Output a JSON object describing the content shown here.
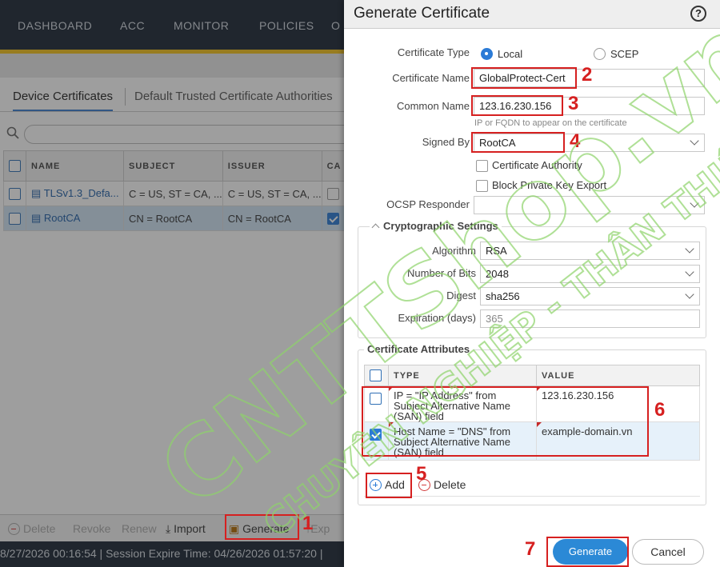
{
  "nav": [
    "DASHBOARD",
    "ACC",
    "MONITOR",
    "POLICIES",
    "O"
  ],
  "tabs": [
    "Device Certificates",
    "Default Trusted Certificate Authorities"
  ],
  "table": {
    "headers": [
      "NAME",
      "SUBJECT",
      "ISSUER",
      "CA"
    ],
    "rows": [
      {
        "name": "TLSv1.3_Defa...",
        "subject": "C = US, ST = CA, ...",
        "issuer": "C = US, ST = CA, ..."
      },
      {
        "name": "RootCA",
        "subject": "CN = RootCA",
        "issuer": "CN = RootCA"
      }
    ]
  },
  "bottombar": {
    "delete": "Delete",
    "revoke": "Revoke",
    "renew": "Renew",
    "import": "Import",
    "generate": "Generate",
    "export": "Exp"
  },
  "status": "8/27/2026 00:16:54 | Session Expire Time: 04/26/2026 01:57:20 |",
  "dialog": {
    "title": "Generate Certificate",
    "help": "?",
    "cert_type_label": "Certificate Type",
    "local": "Local",
    "scep": "SCEP",
    "cert_name_label": "Certificate Name",
    "cert_name": "GlobalProtect-Cert",
    "common_name_label": "Common Name",
    "common_name": "123.16.230.156",
    "common_name_hint": "IP or FQDN to appear on the certificate",
    "signed_by_label": "Signed By",
    "signed_by": "RootCA",
    "cert_authority": "Certificate Authority",
    "block_export": "Block Private Key Export",
    "ocsp_label": "OCSP Responder",
    "crypto_title": "Cryptographic Settings",
    "algorithm_label": "Algorithm",
    "algorithm": "RSA",
    "bits_label": "Number of Bits",
    "bits": "2048",
    "digest_label": "Digest",
    "digest": "sha256",
    "expiration_label": "Expiration (days)",
    "expiration": "365",
    "attrs_title": "Certificate Attributes",
    "attr_headers": [
      "TYPE",
      "VALUE"
    ],
    "attrs": [
      {
        "type": "IP = \"IP Address\" from Subject Alternative Name (SAN) field",
        "value": "123.16.230.156"
      },
      {
        "type": "Host Name = \"DNS\" from Subject Alternative Name (SAN) field",
        "value": "example-domain.vn"
      }
    ],
    "add": "Add",
    "delete": "Delete",
    "generate": "Generate",
    "cancel": "Cancel"
  },
  "annotations": [
    "1",
    "2",
    "3",
    "4",
    "5",
    "6",
    "7"
  ],
  "watermark": {
    "line1": "CNTTShop.vn",
    "line2": "CHUYÊN NGHIỆP - THÂN THIỆN"
  }
}
